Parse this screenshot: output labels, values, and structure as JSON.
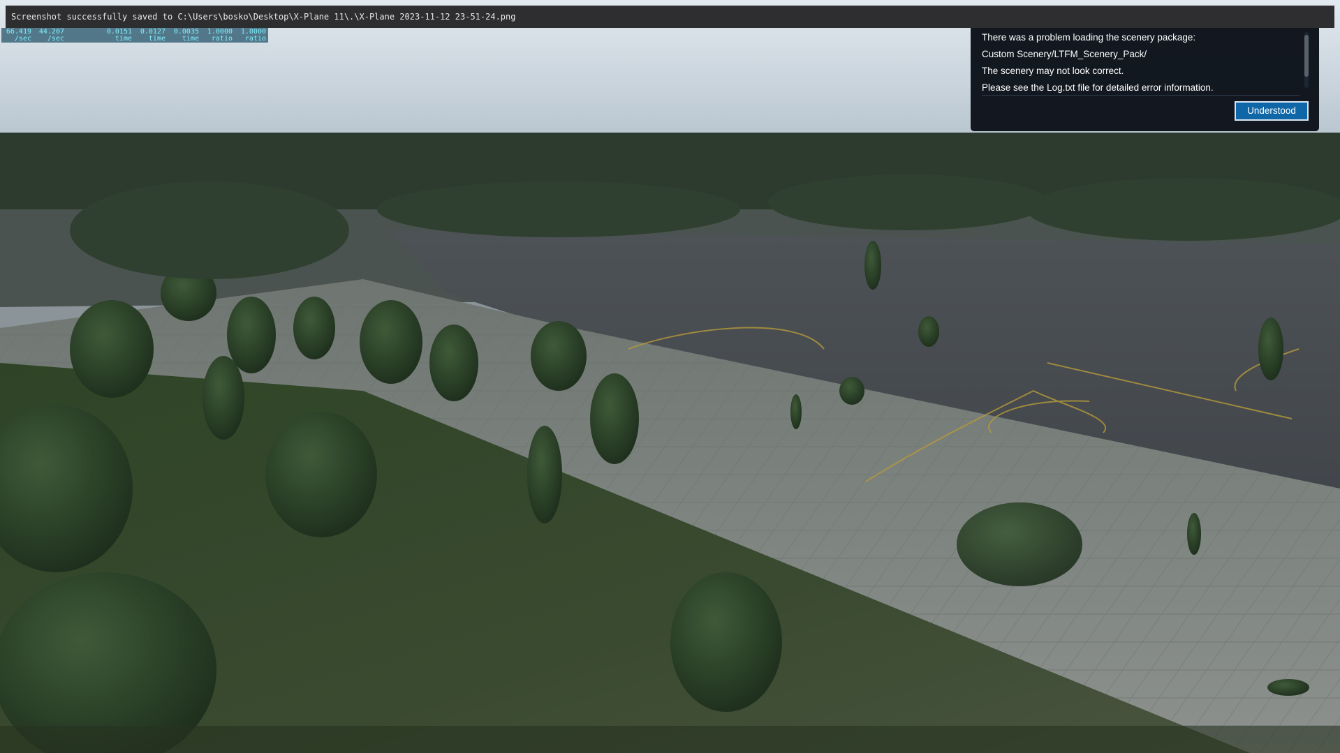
{
  "notification": {
    "text": "Screenshot successfully saved to C:\\Users\\bosko\\Desktop\\X-Plane 11\\.\\X-Plane 2023-11-12 23-51-24.png"
  },
  "stats": [
    {
      "value": "66.419",
      "unit": "/sec"
    },
    {
      "value": "44.207",
      "unit": "/sec"
    },
    {
      "value": "0.0151",
      "unit": "time"
    },
    {
      "value": "0.0127",
      "unit": "time"
    },
    {
      "value": "0.0035",
      "unit": "time"
    },
    {
      "value": "1.0000",
      "unit": "ratio"
    },
    {
      "value": "1.0000",
      "unit": "ratio"
    }
  ],
  "dialog": {
    "lines": [
      "There was a problem loading the scenery package:",
      "Custom Scenery/LTFM_Scenery_Pack/",
      "The scenery may not look correct.",
      "Please see the Log.txt file for detailed error information."
    ],
    "button_label": "Understood"
  },
  "colors": {
    "dialog_bg": "#0a1018",
    "button": "#0f67a8",
    "stats_text": "#7ff0ff"
  }
}
